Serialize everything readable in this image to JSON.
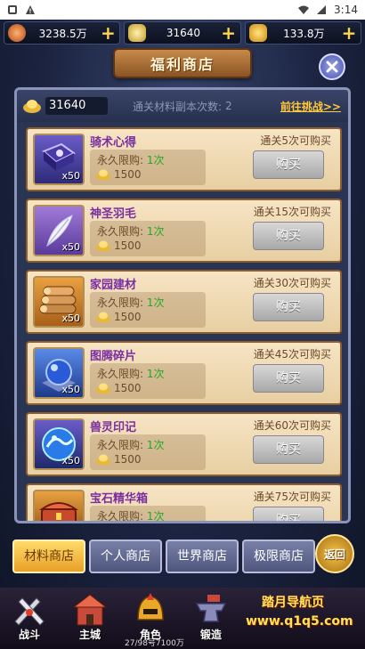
{
  "status": {
    "time": "3:14"
  },
  "resources": [
    {
      "value": "3238.5万",
      "coin": "copper-coin-icon"
    },
    {
      "value": "31640",
      "coin": "silver-ingot-icon"
    },
    {
      "value": "133.8万",
      "coin": "gold-ingot-icon"
    }
  ],
  "title": "福利商店",
  "header": {
    "currency": "31640",
    "clear_label": "通关材料副本次数:",
    "clear_count": "2",
    "challenge_link": "前往挑战>>"
  },
  "items": [
    {
      "name": "骑术心得",
      "qty": "x50",
      "limit_label": "永久限购:",
      "limit_value": "1次",
      "price": "1500",
      "require": "通关5次可购买",
      "buy": "购买",
      "icon": "book-icon"
    },
    {
      "name": "神圣羽毛",
      "qty": "x50",
      "limit_label": "永久限购:",
      "limit_value": "1次",
      "price": "1500",
      "require": "通关15次可购买",
      "buy": "购买",
      "icon": "feather-icon"
    },
    {
      "name": "家园建材",
      "qty": "x50",
      "limit_label": "永久限购:",
      "limit_value": "1次",
      "price": "1500",
      "require": "通关30次可购买",
      "buy": "购买",
      "icon": "logs-icon"
    },
    {
      "name": "图腾碎片",
      "qty": "x50",
      "limit_label": "永久限购:",
      "limit_value": "1次",
      "price": "1500",
      "require": "通关45次可购买",
      "buy": "购买",
      "icon": "orb-icon"
    },
    {
      "name": "兽灵印记",
      "qty": "x50",
      "limit_label": "永久限购:",
      "limit_value": "1次",
      "price": "1500",
      "require": "通关60次可购买",
      "buy": "购买",
      "icon": "dragon-orb-icon"
    },
    {
      "name": "宝石精华箱",
      "qty": "",
      "limit_label": "永久限购:",
      "limit_value": "1次",
      "price": "",
      "require": "通关75次可购买",
      "buy": "购买",
      "icon": "chest-icon"
    }
  ],
  "tabs": [
    "材料商店",
    "个人商店",
    "世界商店",
    "极限商店"
  ],
  "back_label": "返回",
  "nav": [
    {
      "label": "战斗",
      "icon": "swords-icon"
    },
    {
      "label": "主城",
      "icon": "castle-icon"
    },
    {
      "label": "角色",
      "icon": "helmet-icon"
    },
    {
      "label": "锻造",
      "icon": "anvil-icon"
    }
  ],
  "promo": {
    "line1": "踏月导航页",
    "line2": "www.q1q5.com"
  },
  "ticker": "27/98号7100万"
}
